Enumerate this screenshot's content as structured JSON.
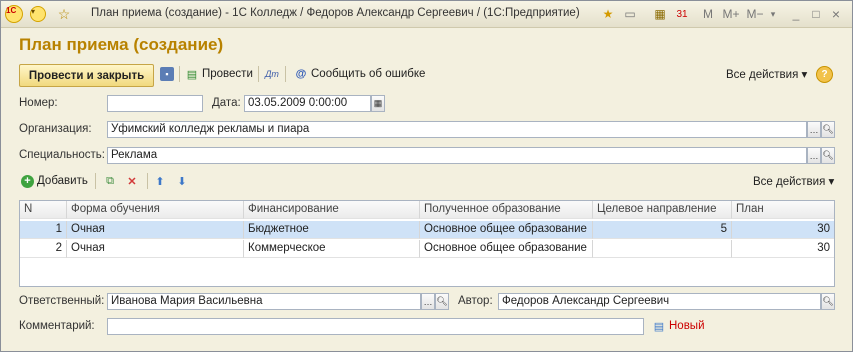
{
  "window": {
    "title": "План приема (создание) - 1С Колледж / Федоров Александр Сергеевич /  (1С:Предприятие)"
  },
  "titlebar_icons": [
    "1c-logo-icon",
    "dropdown-icon",
    "star-icon"
  ],
  "titlebar_right": {
    "m": "M",
    "mplus": "M+",
    "mminus": "M−",
    "min": "_",
    "max": "□",
    "close": "×"
  },
  "form": {
    "title": "План приема (создание)"
  },
  "toolbar": {
    "post_close": "Провести и закрыть",
    "post": "Провести",
    "report_error": "Сообщить об ошибке",
    "all_actions": "Все действия ▾",
    "help": "?"
  },
  "fields": {
    "number_label": "Номер:",
    "number_value": "",
    "date_label": "Дата:",
    "date_value": "03.05.2009  0:00:00",
    "org_label": "Организация:",
    "org_value": "Уфимский колледж рекламы и пиара",
    "spec_label": "Специальность:",
    "spec_value": "Реклама",
    "responsible_label": "Ответственный:",
    "responsible_value": "Иванова Мария Васильевна",
    "author_label": "Автор:",
    "author_value": "Федоров Александр Сергеевич",
    "comment_label": "Комментарий:",
    "comment_value": "",
    "new_link": "Новый"
  },
  "table_toolbar": {
    "add": "Добавить",
    "all_actions": "Все действия ▾"
  },
  "table": {
    "columns": [
      "N",
      "Форма обучения",
      "Финансирование",
      "Полученное образование",
      "Целевое направление",
      "План"
    ],
    "rows": [
      [
        "1",
        "Очная",
        "Бюджетное",
        "Основное общее образование",
        "5",
        "30"
      ],
      [
        "2",
        "Очная",
        "Коммерческое",
        "Основное общее образование",
        "",
        "30"
      ]
    ]
  }
}
